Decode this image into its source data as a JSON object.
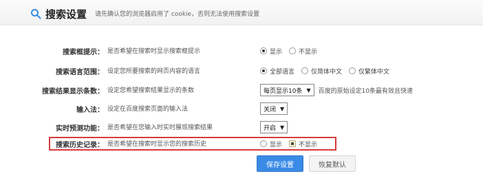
{
  "header": {
    "title": "搜索设置",
    "notice": "请先确认您的浏览器启用了 cookie，否则无法使用搜索设置"
  },
  "rows": [
    {
      "label": "搜索框提示：",
      "desc": "是否希望在搜索时显示搜索框提示",
      "options": [
        "显示",
        "不显示"
      ],
      "selected": "显示"
    },
    {
      "label": "搜索语言范围：",
      "desc": "设定您所要搜索的网页内容的语言",
      "options": [
        "全部语言",
        "仅简体中文",
        "仅繁体中文"
      ],
      "selected": "全部语言"
    },
    {
      "label": "搜索结果显示条数：",
      "desc": "设定您希望搜索结果显示的条数",
      "select_value": "每页显示10条",
      "note": "百度的原始设定10条最有效且快速"
    },
    {
      "label": "输入法：",
      "desc": "设定在百度搜索页面的输入法",
      "select_value": "关闭"
    },
    {
      "label": "实时预测功能：",
      "desc": "是否希望在您输入时实时展现搜索结果",
      "select_value": "开启"
    },
    {
      "label": "搜索历史记录：",
      "desc": "是否希望在搜索时显示您的搜索历史",
      "options": [
        "显示",
        "不显示"
      ],
      "selected": "不显示"
    }
  ],
  "buttons": {
    "save": "保存设置",
    "reset": "恢复默认"
  },
  "colors": {
    "highlight_border": "#d93a3a",
    "save_bg": "#3a8be6"
  }
}
